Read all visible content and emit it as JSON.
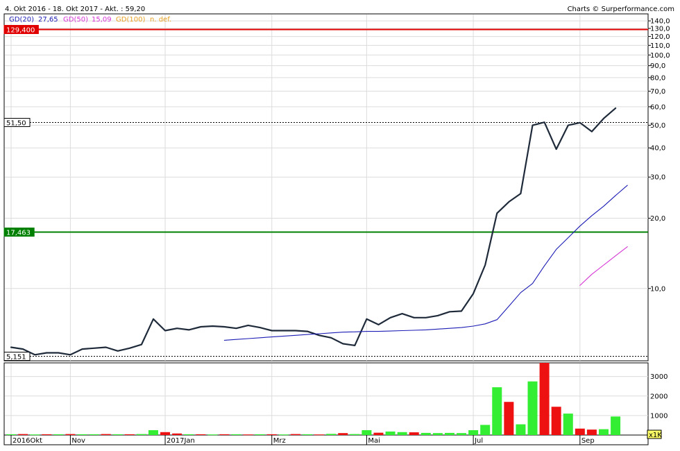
{
  "header": {
    "range_text": "4. Okt 2016 - 18. Okt 2017 - Akt. : 59,20",
    "credit_text": "Charts © Surperformance.com"
  },
  "legend": [
    {
      "label": "GD(20)",
      "value": "27,65",
      "color": "#1b1bb5"
    },
    {
      "label": "GD(50)",
      "value": "15,09",
      "color": "#d633d6"
    },
    {
      "label": "GD(100)",
      "value": "n. def.",
      "color": "#e8a020"
    }
  ],
  "colors": {
    "price_line": "#1e2a3a",
    "resistance": "#e00000",
    "support": "#008000",
    "volume_up": "#33ee33",
    "volume_down": "#ee1111",
    "grid": "#dcdcdc"
  },
  "chart_data": [
    {
      "type": "line",
      "y_scale": "log",
      "ylim": [
        4.9,
        150
      ],
      "y_ticks": [
        10,
        20,
        30,
        40,
        50,
        60,
        70,
        80,
        90,
        100,
        110,
        120,
        130,
        140
      ],
      "y_tick_labels": [
        "10,0",
        "20,0",
        "30,0",
        "40,0",
        "50,0",
        "60,0",
        "70,0",
        "80,0",
        "90,0",
        "100,0",
        "110,0",
        "120,0",
        "130,0",
        "140,0"
      ],
      "x_labels": [
        {
          "label": "2016Okt",
          "index": 0
        },
        {
          "label": "Nov",
          "index": 5
        },
        {
          "label": "2017Jan",
          "index": 13
        },
        {
          "label": "Mrz",
          "index": 22
        },
        {
          "label": "Mai",
          "index": 30
        },
        {
          "label": "Jul",
          "index": 39
        },
        {
          "label": "Sep",
          "index": 48
        }
      ],
      "n_points": 55,
      "series": [
        {
          "name": "price",
          "values": [
            5.6,
            5.5,
            5.2,
            5.3,
            5.3,
            5.2,
            5.5,
            5.55,
            5.6,
            5.4,
            5.55,
            5.75,
            7.4,
            6.6,
            6.75,
            6.65,
            6.85,
            6.9,
            6.85,
            6.75,
            6.95,
            6.8,
            6.6,
            6.6,
            6.6,
            6.55,
            6.3,
            6.15,
            5.8,
            5.7,
            7.4,
            7.0,
            7.5,
            7.8,
            7.5,
            7.5,
            7.65,
            7.95,
            8.0,
            9.5,
            12.6,
            21.0,
            23.5,
            25.5,
            50.0,
            51.5,
            39.5,
            50.0,
            51.3,
            47.0,
            53.5,
            59.2
          ]
        },
        {
          "name": "GD(20)",
          "start_index": 18,
          "values": [
            6.0,
            6.05,
            6.1,
            6.15,
            6.2,
            6.25,
            6.3,
            6.35,
            6.4,
            6.45,
            6.5,
            6.52,
            6.55,
            6.55,
            6.57,
            6.6,
            6.62,
            6.65,
            6.7,
            6.75,
            6.8,
            6.9,
            7.05,
            7.35,
            8.4,
            9.6,
            10.5,
            12.5,
            14.7,
            16.5,
            18.5,
            20.5,
            22.5,
            25.0,
            27.65
          ]
        },
        {
          "name": "GD(50)",
          "start_index": 48,
          "values": [
            10.3,
            11.5,
            12.6,
            13.8,
            15.09
          ]
        }
      ],
      "reference_lines": [
        {
          "value": 129.4,
          "label": "129,400",
          "style": "solid",
          "color": "#e00000"
        },
        {
          "value": 51.5,
          "label": "51,50",
          "style": "dotted",
          "color": "#000000"
        },
        {
          "value": 17.463,
          "label": "17,463",
          "style": "solid",
          "color": "#008000"
        },
        {
          "value": 5.151,
          "label": "5,151",
          "style": "dotted",
          "color": "#000000"
        }
      ]
    },
    {
      "type": "bar",
      "name": "volume",
      "unit_label": "x1K",
      "ylim": [
        0,
        3700
      ],
      "y_ticks": [
        1000,
        2000,
        3000
      ],
      "y_tick_labels": [
        "1000",
        "2000",
        "3000"
      ],
      "values": [
        40,
        50,
        30,
        40,
        40,
        50,
        40,
        40,
        50,
        40,
        40,
        50,
        250,
        150,
        80,
        40,
        40,
        30,
        40,
        40,
        30,
        40,
        40,
        30,
        50,
        40,
        30,
        60,
        100,
        50,
        250,
        120,
        180,
        150,
        140,
        110,
        100,
        110,
        100,
        250,
        520,
        2450,
        1700,
        550,
        2750,
        3700,
        1450,
        1100,
        330,
        280,
        300,
        950
      ],
      "up": [
        true,
        false,
        true,
        false,
        true,
        false,
        true,
        true,
        false,
        true,
        false,
        true,
        true,
        false,
        false,
        true,
        false,
        true,
        false,
        true,
        false,
        true,
        false,
        true,
        false,
        true,
        false,
        true,
        false,
        true,
        true,
        false,
        true,
        true,
        false,
        true,
        true,
        true,
        true,
        true,
        true,
        true,
        false,
        true,
        true,
        false,
        false,
        true,
        false,
        false,
        true,
        true
      ]
    }
  ]
}
